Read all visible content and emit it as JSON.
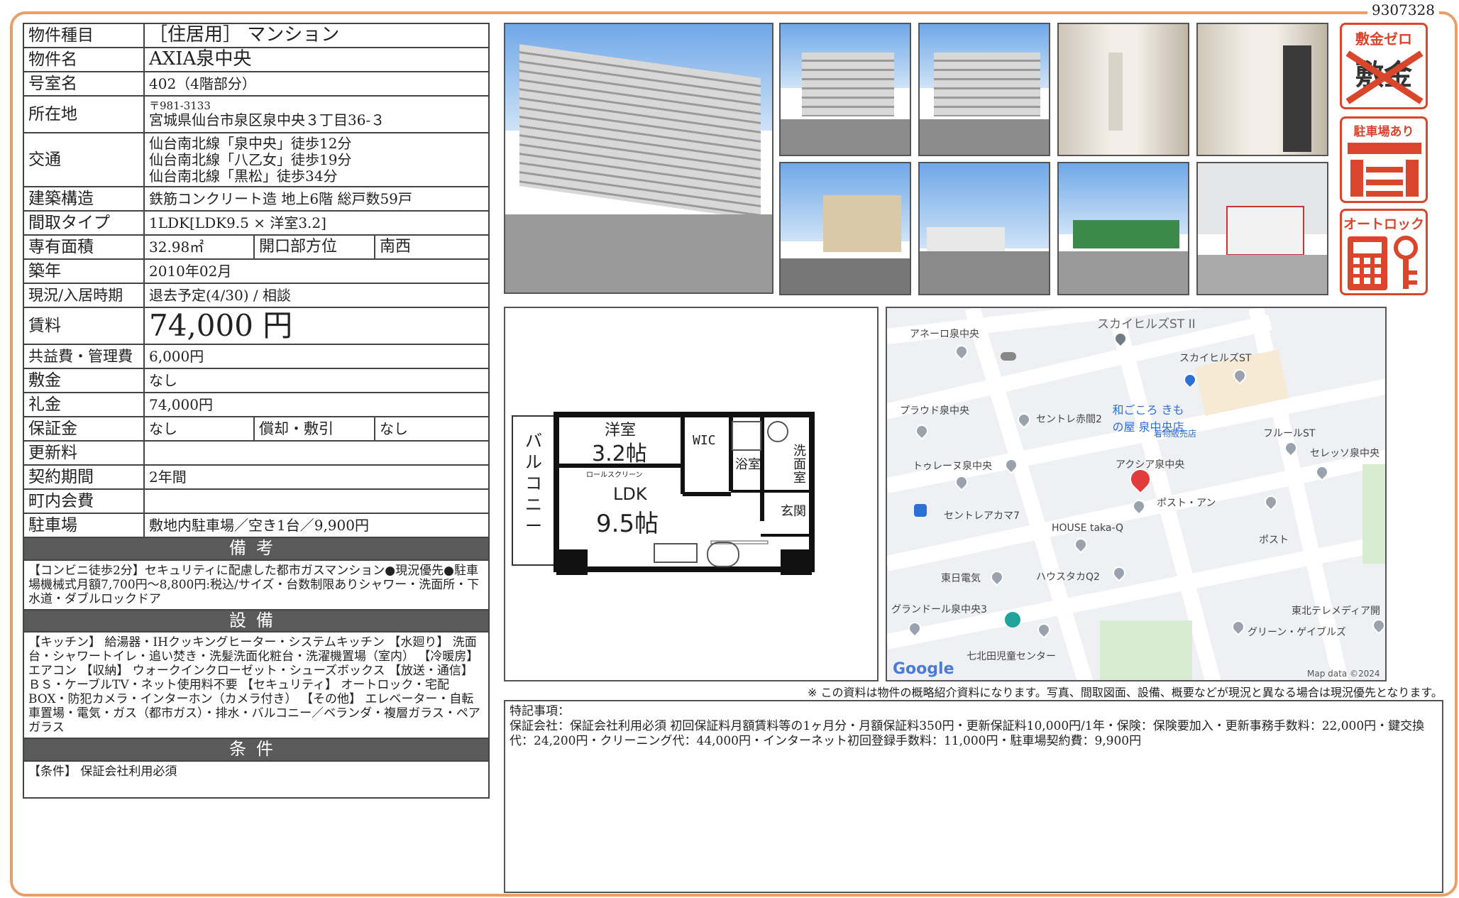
{
  "doc_id": "9307328",
  "spec": {
    "type_label": "物件種目",
    "type_value": "［住居用］ マンション",
    "name_label": "物件名",
    "name_value": "AXIA泉中央",
    "room_label": "号室名",
    "room_value": "402（4階部分）",
    "address_label": "所在地",
    "address_postal": "〒981-3133",
    "address_value": "宮城県仙台市泉区泉中央３丁目36-３",
    "transit_label": "交通",
    "transit_1": "仙台南北線「泉中央」徒歩12分",
    "transit_2": "仙台南北線「八乙女」徒歩19分",
    "transit_3": "仙台南北線「黒松」徒歩34分",
    "structure_label": "建築構造",
    "structure_value": "鉄筋コンクリート造 地上6階 総戸数59戸",
    "layout_label": "間取タイプ",
    "layout_value": "1LDK[LDK9.5 × 洋室3.2]",
    "area_label": "専有面積",
    "area_value": "32.98㎡",
    "direction_label": "開口部方位",
    "direction_value": "南西",
    "built_label": "築年",
    "built_value": "2010年02月",
    "status_label": "現況/入居時期",
    "status_value": "退去予定(4/30) / 相談",
    "rent_label": "賃料",
    "rent_value": "74,000 円",
    "fee_label": "共益費・管理費",
    "fee_value": "6,000円",
    "deposit_label": "敷金",
    "deposit_value": "なし",
    "key_money_label": "礼金",
    "key_money_value": "74,000円",
    "guarantee_label": "保証金",
    "guarantee_value": "なし",
    "amort_label": "償却・敷引",
    "amort_value": "なし",
    "renewal_label": "更新料",
    "renewal_value": "",
    "contract_label": "契約期間",
    "contract_value": "2年間",
    "assoc_label": "町内会費",
    "assoc_value": "",
    "parking_label": "駐車場",
    "parking_value": "敷地内駐車場／空き1台／9,900円"
  },
  "remarks": {
    "header": "備考",
    "text": "【コンビニ徒歩2分】セキュリティに配慮した都市ガスマンション●現況優先●駐車場機械式月額7,700円～8,800円:税込/サイズ・台数制限ありシャワー・洗面所・下水道・ダブルロックドア"
  },
  "equipment": {
    "header": "設備",
    "text": "【キッチン】 給湯器・IHクッキングヒーター・システムキッチン 【水廻り】 洗面台・シャワートイレ・追い焚き・洗髪洗面化粧台・洗濯機置場（室内） 【冷暖房】 エアコン 【収納】 ウォークインクローゼット・シューズボックス 【放送・通信】 ＢＳ・ケーブルTV・ネット使用料不要 【セキュリティ】 オートロック・宅配BOX・防犯カメラ・インターホン（カメラ付き） 【その他】 エレベーター・自転車置場・電気・ガス（都市ガス）・排水・バルコニー／ベランダ・複層ガラス・ペアガラス"
  },
  "conditions": {
    "header": "条件",
    "text": "【条件】 保証会社利用必須"
  },
  "badges": {
    "zero_deposit_title": "敷金ゼロ",
    "zero_deposit_kanji": "敷金",
    "parking_title": "駐車場あり",
    "autolock_title": "オートロック"
  },
  "floor_plan": {
    "room1_name": "洋室",
    "room1_size": "3.2帖",
    "ldk_name": "LDK",
    "ldk_size": "9.5帖",
    "wic": "WIC",
    "bath": "浴室",
    "wash": "洗面室",
    "entrance": "玄関",
    "balcony": "バルコニー",
    "screen": "ロールスクリーン"
  },
  "map": {
    "labels": [
      "スカイヒルズST II",
      "アネーロ泉中央",
      "スカイヒルズST",
      "プラウド泉中央",
      "セントレ赤間2",
      "和ごころ きもの屋 泉中央店",
      "着物販売店",
      "フルールST",
      "トゥレーヌ泉中央",
      "アクシア泉中央",
      "セレッソ泉中央",
      "ポスト・アン",
      "セントレアカマ7",
      "HOUSE taka-Q",
      "ポスト",
      "東日電気",
      "ハウスタカQ2",
      "グランドール泉中央3",
      "東北テレメディア開",
      "グリーン・ゲイブルズ",
      "七北田児童センター"
    ],
    "google": "Google",
    "attribution": "Map data ©2024"
  },
  "disclaimer": "※ この資料は物件の概略紹介資料になります。写真、間取図面、設備、概要などが現況と異なる場合は現況優先となります。",
  "special": {
    "title": "特記事項：",
    "text": "保証会社：保証会社利用必須 初回保証料月額賃料等の1ヶ月分・月額保証料350円・更新保証料10,000円/1年・保険：保険要加入・更新事務手数料：22,000円・鍵交換代：24,200円・クリーニング代：44,000円・インターネット初回登録手数料：11,000円・駐車場契約費：9,900円"
  }
}
